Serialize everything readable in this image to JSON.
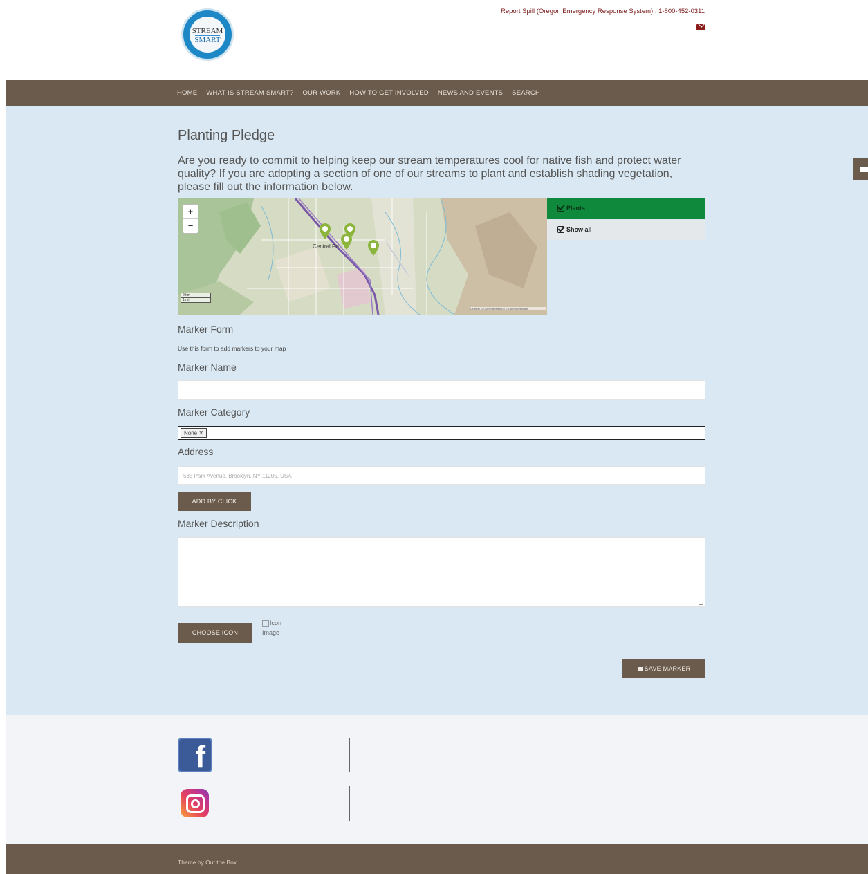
{
  "header": {
    "logo_top": "STREAM",
    "logo_bottom": "SMART",
    "report_text": "Report Spill (Oregon Emergency Response System) : 1-800-452-0311"
  },
  "nav": {
    "items": [
      "HOME",
      "WHAT IS STREAM SMART?",
      "OUR WORK",
      "HOW TO GET INVOLVED",
      "NEWS AND EVENTS",
      "SEARCH"
    ]
  },
  "page": {
    "title": "Planting Pledge",
    "intro": "Are you ready to commit to helping keep our stream temperatures cool for native fish and protect water quality? If you are adopting a section of one of our streams to plant and establish shading vegetation, please fill out the information below."
  },
  "map": {
    "zoom_in": "+",
    "zoom_out": "−",
    "town_label": "Central Po",
    "scale_km": "2 km",
    "scale_mi": "1 mi",
    "attribution": "Leaflet | © OpenStreetMap | © OpenStreetMap",
    "layers": [
      "Plants",
      "Show all"
    ]
  },
  "form": {
    "heading": "Marker Form",
    "help": "Use this form to add markers to your map",
    "name_label": "Marker Name",
    "name_value": "",
    "category_label": "Marker Category",
    "category_tag": "None ✕",
    "address_label": "Address",
    "address_placeholder": "535 Park Avenue, Brooklyn, NY 11205, USA",
    "add_by_click": "ADD BY CLICK",
    "description_label": "Marker Description",
    "description_value": "",
    "choose_icon": "CHOOSE ICON",
    "icon_alt_1": "Icon",
    "icon_alt_2": "Image",
    "save_marker": "SAVE MARKER"
  },
  "footer": {
    "theme": "Theme by Out the Box"
  },
  "colors": {
    "nav_bg": "#6b5b4c",
    "main_bg": "#d9e8f2",
    "plants_layer": "#0f8a3c",
    "marker": "#8cb53e"
  },
  "icons": [
    "logo",
    "mail-icon",
    "zoom-in-icon",
    "zoom-out-icon",
    "checkbox-icon",
    "map-marker-icon",
    "save-icon",
    "facebook-icon",
    "instagram-icon"
  ]
}
